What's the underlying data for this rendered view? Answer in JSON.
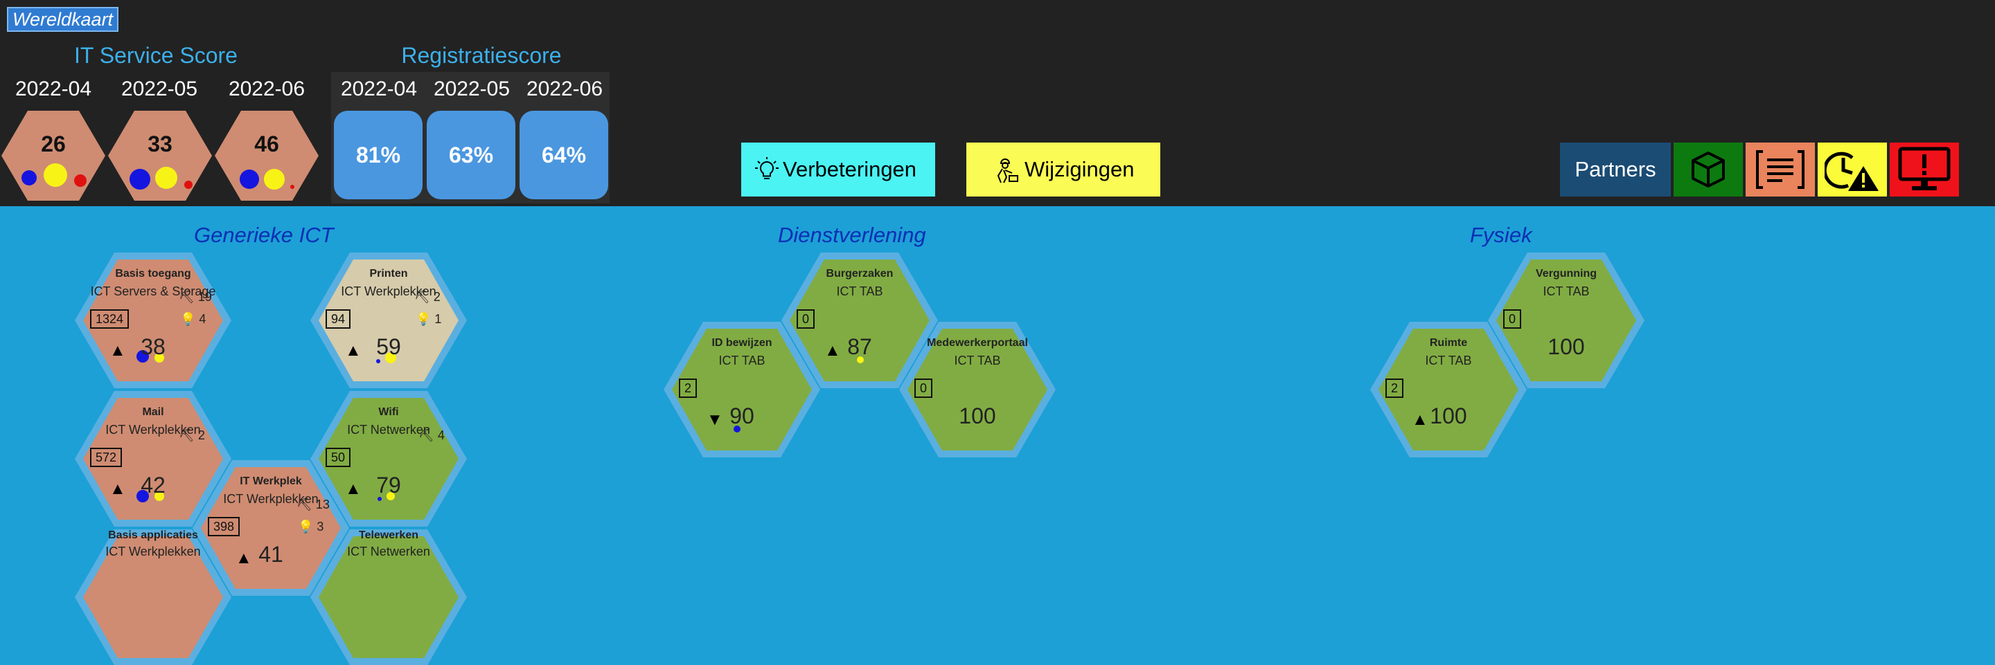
{
  "app": {
    "title": "Wereldkaart"
  },
  "service_score": {
    "title": "IT Service Score",
    "months": [
      {
        "label": "2022-04",
        "value": "26"
      },
      {
        "label": "2022-05",
        "value": "33"
      },
      {
        "label": "2022-06",
        "value": "46"
      }
    ]
  },
  "registration_score": {
    "title": "Registratiescore",
    "months": [
      {
        "label": "2022-04",
        "value": "81%"
      },
      {
        "label": "2022-05",
        "value": "63%"
      },
      {
        "label": "2022-06",
        "value": "64%"
      }
    ]
  },
  "buttons": {
    "improvements": "Verbeteringen",
    "changes": "Wijzigingen",
    "partners": "Partners"
  },
  "categories": {
    "generic": "Generieke ICT",
    "services": "Dienstverlening",
    "physical": "Fysiek"
  },
  "tiles": {
    "basis_toegang": {
      "name": "Basis toegang",
      "sub": "ICT Servers & Storage",
      "count": "1324",
      "score": "38",
      "changes": "19",
      "improvements": "4"
    },
    "printen": {
      "name": "Printen",
      "sub": "ICT Werkplekken",
      "count": "94",
      "score": "59",
      "changes": "2",
      "improvements": "1"
    },
    "mail": {
      "name": "Mail",
      "sub": "ICT Werkplekken",
      "count": "572",
      "score": "42",
      "changes": "2"
    },
    "wifi": {
      "name": "Wifi",
      "sub": "ICT Netwerken",
      "count": "50",
      "score": "79",
      "changes": "4"
    },
    "it_werkplek": {
      "name": "IT Werkplek",
      "sub": "ICT Werkplekken",
      "count": "398",
      "score": "41",
      "changes": "13",
      "improvements": "3"
    },
    "basis_applicaties": {
      "name": "Basis applicaties",
      "sub": "ICT Werkplekken"
    },
    "telewerken": {
      "name": "Telewerken",
      "sub": "ICT Netwerken"
    },
    "burgerzaken": {
      "name": "Burgerzaken",
      "sub": "ICT TAB",
      "count": "0",
      "score": "87"
    },
    "id_bewijzen": {
      "name": "ID bewijzen",
      "sub": "ICT TAB",
      "count": "2",
      "score": "90"
    },
    "medewerkerportaal": {
      "name": "Medewerkerportaal",
      "sub": "ICT TAB",
      "count": "0",
      "score": "100"
    },
    "vergunning": {
      "name": "Vergunning",
      "sub": "ICT TAB",
      "count": "0",
      "score": "100"
    },
    "ruimte": {
      "name": "Ruimte",
      "sub": "ICT TAB",
      "count": "2",
      "score": "100"
    }
  },
  "colors": {
    "header_bg": "#222222",
    "map_bg": "#1da0d6",
    "hex_salmon": "#cf8c72",
    "hex_beige": "#d6cbaa",
    "hex_green": "#81ac43",
    "improve_btn": "#4bf3f3",
    "change_btn": "#fbfb55",
    "partners_btn": "#1b4c74"
  }
}
